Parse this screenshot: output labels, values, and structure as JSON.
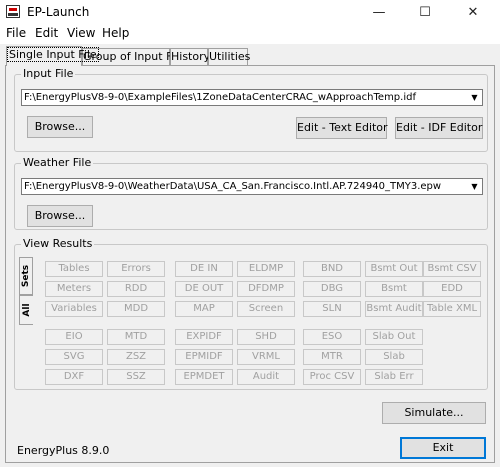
{
  "window": {
    "title": "EP-Launch",
    "minimize_glyph": "—",
    "maximize_glyph": "☐",
    "close_glyph": "✕"
  },
  "menu": [
    "File",
    "Edit",
    "View",
    "Help"
  ],
  "tabs": [
    "Single Input File",
    "Group of Input Files",
    "History",
    "Utilities"
  ],
  "input_file": {
    "label": "Input File",
    "path": "F:\\EnergyPlusV8-9-0\\ExampleFiles\\1ZoneDataCenterCRAC_wApproachTemp.idf",
    "browse": "Browse...",
    "edit_text": "Edit - Text Editor",
    "edit_idf": "Edit - IDF Editor"
  },
  "weather_file": {
    "label": "Weather File",
    "path": "F:\\EnergyPlusV8-9-0\\WeatherData\\USA_CA_San.Francisco.Intl.AP.724940_TMY3.epw",
    "browse": "Browse..."
  },
  "view_results": {
    "label": "View Results",
    "side_tabs": [
      "Sets",
      "All"
    ],
    "buttons": [
      [
        "Tables",
        "Errors",
        "DE IN",
        "ELDMP",
        "BND",
        "Bsmt Out",
        "Bsmt CSV"
      ],
      [
        "Meters",
        "RDD",
        "DE OUT",
        "DFDMP",
        "DBG",
        "Bsmt",
        "EDD"
      ],
      [
        "Variables",
        "MDD",
        "MAP",
        "Screen",
        "SLN",
        "Bsmt Audit",
        "Table XML"
      ],
      [
        "EIO",
        "MTD",
        "EXPIDF",
        "SHD",
        "ESO",
        "Slab Out"
      ],
      [
        "SVG",
        "ZSZ",
        "EPMIDF",
        "VRML",
        "MTR",
        "Slab"
      ],
      [
        "DXF",
        "SSZ",
        "EPMDET",
        "Audit",
        "Proc CSV",
        "Slab Err"
      ]
    ]
  },
  "simulate": "Simulate...",
  "exit": "Exit",
  "version": "EnergyPlus 8.9.0",
  "icons": {
    "app": "ep-launch-icon",
    "dropdown": "▼"
  }
}
